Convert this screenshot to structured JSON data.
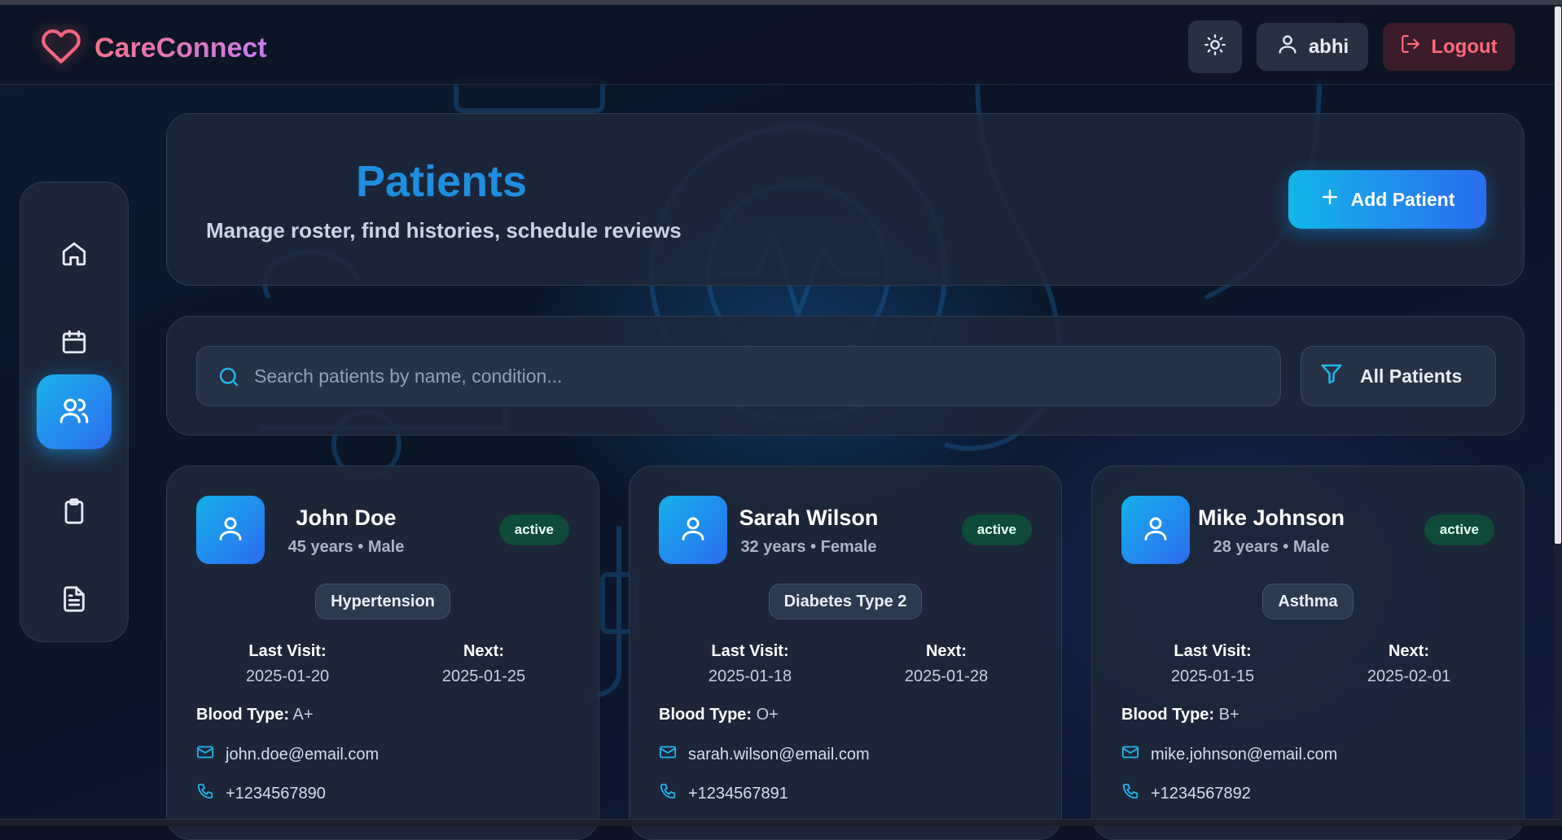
{
  "app": {
    "name": "CareConnect"
  },
  "header": {
    "user_name": "abhi",
    "logout_label": "Logout"
  },
  "sidebar": {
    "items": [
      {
        "name": "home",
        "icon": "home-icon",
        "active": false
      },
      {
        "name": "appointments",
        "icon": "calendar-icon",
        "active": false
      },
      {
        "name": "patients",
        "icon": "users-icon",
        "active": true
      },
      {
        "name": "records",
        "icon": "clipboard-icon",
        "active": false
      },
      {
        "name": "reports",
        "icon": "file-text-icon",
        "active": false
      }
    ]
  },
  "hero": {
    "title": "Patients",
    "subtitle": "Manage roster, find histories, schedule reviews",
    "add_button_label": "Add Patient"
  },
  "search": {
    "placeholder": "Search patients by name, condition...",
    "value": "",
    "filter_label": "All Patients"
  },
  "patients": [
    {
      "name": "John Doe",
      "meta": "45 years • Male",
      "status": "active",
      "condition": "Hypertension",
      "last_visit_label": "Last Visit:",
      "last_visit": "2025-01-20",
      "next_label": "Next:",
      "next": "2025-01-25",
      "blood_label": "Blood Type:",
      "blood_type": "A+",
      "email": "john.doe@email.com",
      "phone": "+1234567890"
    },
    {
      "name": "Sarah Wilson",
      "meta": "32 years • Female",
      "status": "active",
      "condition": "Diabetes Type 2",
      "last_visit_label": "Last Visit:",
      "last_visit": "2025-01-18",
      "next_label": "Next:",
      "next": "2025-01-28",
      "blood_label": "Blood Type:",
      "blood_type": "O+",
      "email": "sarah.wilson@email.com",
      "phone": "+1234567891"
    },
    {
      "name": "Mike Johnson",
      "meta": "28 years • Male",
      "status": "active",
      "condition": "Asthma",
      "last_visit_label": "Last Visit:",
      "last_visit": "2025-01-15",
      "next_label": "Next:",
      "next": "2025-02-01",
      "blood_label": "Blood Type:",
      "blood_type": "B+",
      "email": "mike.johnson@email.com",
      "phone": "+1234567892"
    }
  ],
  "colors": {
    "accent": "#1f8ee0",
    "brand_gradient_start": "#f4728c",
    "brand_gradient_end": "#c97bf0",
    "status_active_bg": "#0f4a3a",
    "logout": "#ff6b7a"
  }
}
